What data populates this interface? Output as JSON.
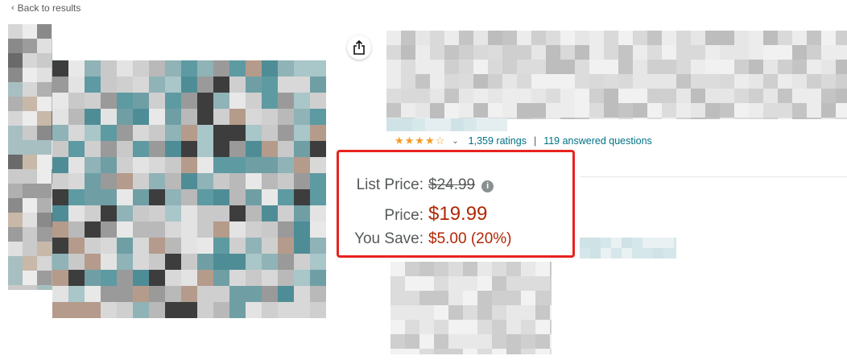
{
  "nav": {
    "back_label": "Back to results",
    "back_icon": "chevron-left-icon"
  },
  "share": {
    "icon": "share-icon"
  },
  "rating": {
    "stars": "★★★★☆",
    "stars_value": 4.0,
    "ratings_count": "1,359 ratings",
    "answered_questions": "119 answered questions",
    "separator": "|"
  },
  "price": {
    "list_label": "List Price:",
    "list_value": "$24.99",
    "price_label": "Price:",
    "price_value": "$19.99",
    "save_label": "You Save:",
    "save_value": "$5.00 (20%)"
  },
  "colors": {
    "price_red": "#b12704",
    "highlight_border": "#e8231f",
    "link": "#007185",
    "star": "#f49b25"
  }
}
